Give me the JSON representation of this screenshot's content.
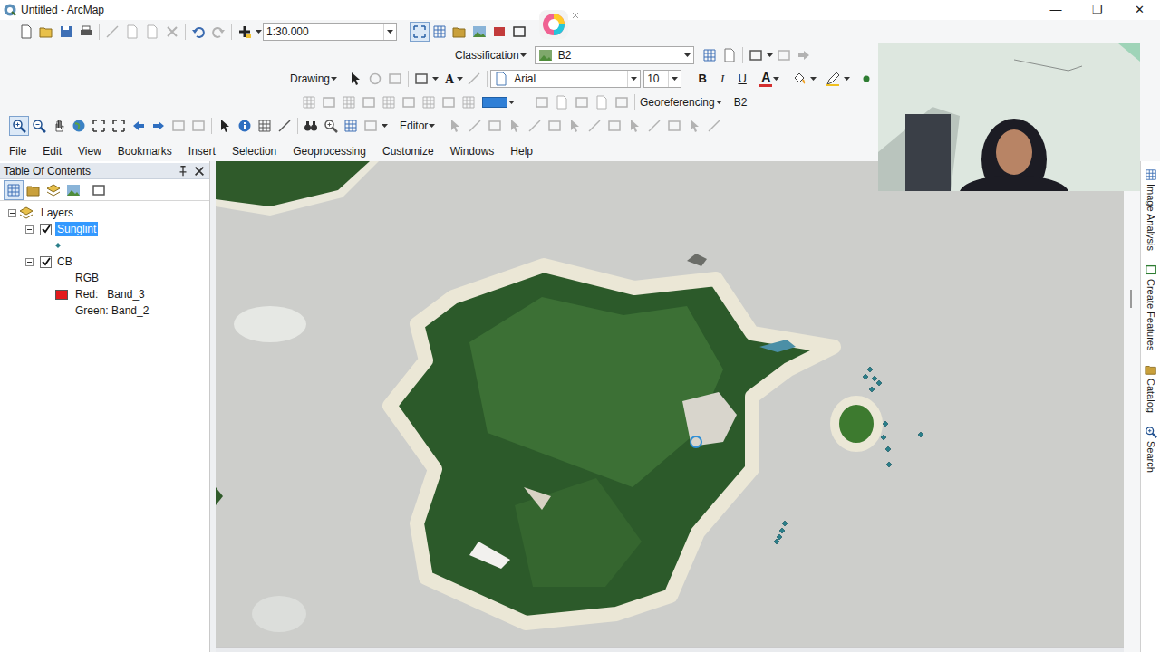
{
  "window": {
    "title": "Untitled - ArcMap",
    "controls": [
      "—",
      "❐",
      "✕"
    ]
  },
  "standard_toolbar": {
    "scale": "1:30.000"
  },
  "classification_toolbar": {
    "label": "Classification",
    "layer": "B2"
  },
  "draw_toolbar": {
    "label": "Drawing",
    "text_tool": "A",
    "font": "Arial",
    "size": "10",
    "styles": [
      "B",
      "I",
      "U"
    ],
    "font_color": "A"
  },
  "georef_toolbar": {
    "label": "Georeferencing",
    "layer": "B2"
  },
  "editor_toolbar": {
    "label": "Editor"
  },
  "menu": [
    "File",
    "Edit",
    "View",
    "Bookmarks",
    "Insert",
    "Selection",
    "Geoprocessing",
    "Customize",
    "Windows",
    "Help"
  ],
  "toc": {
    "title": "Table Of Contents",
    "items": [
      {
        "label": "Layers",
        "kind": "group",
        "expanded": true,
        "selected": false
      },
      {
        "label": "Sunglint",
        "kind": "layer",
        "expanded": true,
        "checked": true,
        "selected": true
      },
      {
        "kind": "point-symbol"
      },
      {
        "label": "CB",
        "kind": "layer",
        "expanded": true,
        "checked": true,
        "selected": false
      },
      {
        "label": "RGB",
        "kind": "heading",
        "selected": false
      },
      {
        "label": "Red:   Band_3",
        "kind": "band",
        "color": "#e31a1c",
        "selected": false
      },
      {
        "label": "Green: Band_2",
        "kind": "band-plain",
        "selected": false
      }
    ]
  },
  "side_tabs": [
    "Image Analysis",
    "Create Features",
    "Catalog",
    "Search"
  ]
}
